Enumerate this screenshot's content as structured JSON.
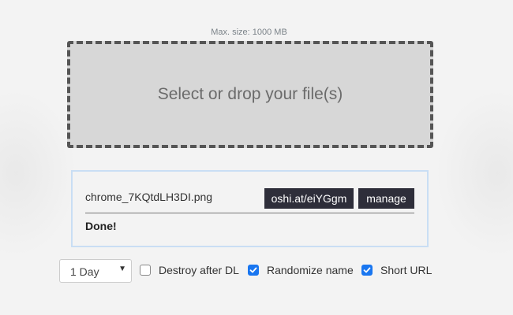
{
  "upload": {
    "max_size_label": "Max. size: 1000 MB",
    "dropzone_label": "Select or drop your file(s)"
  },
  "file": {
    "name": "chrome_7KQtdLH3DI.png",
    "link_label": "oshi.at/eiYGgm",
    "manage_label": "manage",
    "status": "Done!"
  },
  "options": {
    "expiry": {
      "selected": "1 Day"
    },
    "destroy_after_dl": {
      "label": "Destroy after DL",
      "checked": false
    },
    "randomize_name": {
      "label": "Randomize name",
      "checked": true
    },
    "short_url": {
      "label": "Short URL",
      "checked": true
    }
  },
  "colors": {
    "checkbox_checked": "#1976f0",
    "dark_button": "#2e2e3a",
    "card_border": "#c9def4",
    "dropzone_bg": "#d7d7d7"
  },
  "icons": {
    "select_arrow": "chevron-down-icon",
    "checkmark": "check-icon"
  }
}
